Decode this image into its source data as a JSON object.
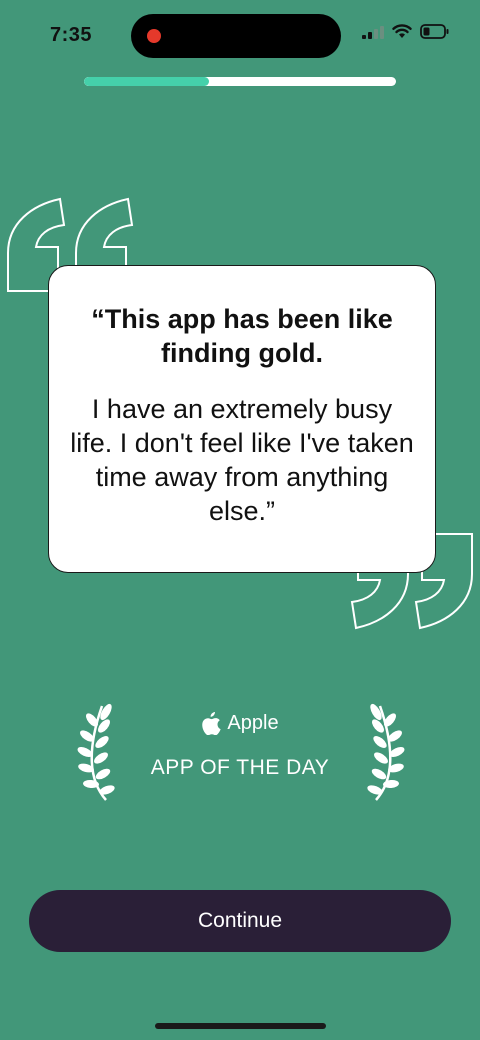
{
  "status_bar": {
    "time": "7:35",
    "icons": [
      "cellular-signal-icon",
      "wifi-icon",
      "battery-icon"
    ]
  },
  "progress": {
    "fraction": 0.4,
    "fill_color": "#45d0aa",
    "track_color": "#ffffff"
  },
  "testimonial": {
    "headline": "“This app has been like finding gold.",
    "body": "I have an extremely busy life. I don't feel like I've taken time away from anything else.”"
  },
  "award": {
    "brand": "Apple",
    "title": "APP OF THE DAY",
    "icons": [
      "apple-logo-icon",
      "laurel-left-icon",
      "laurel-right-icon"
    ]
  },
  "actions": {
    "continue_label": "Continue"
  },
  "colors": {
    "background": "#429779",
    "button": "#2a1f37",
    "card": "#ffffff"
  }
}
